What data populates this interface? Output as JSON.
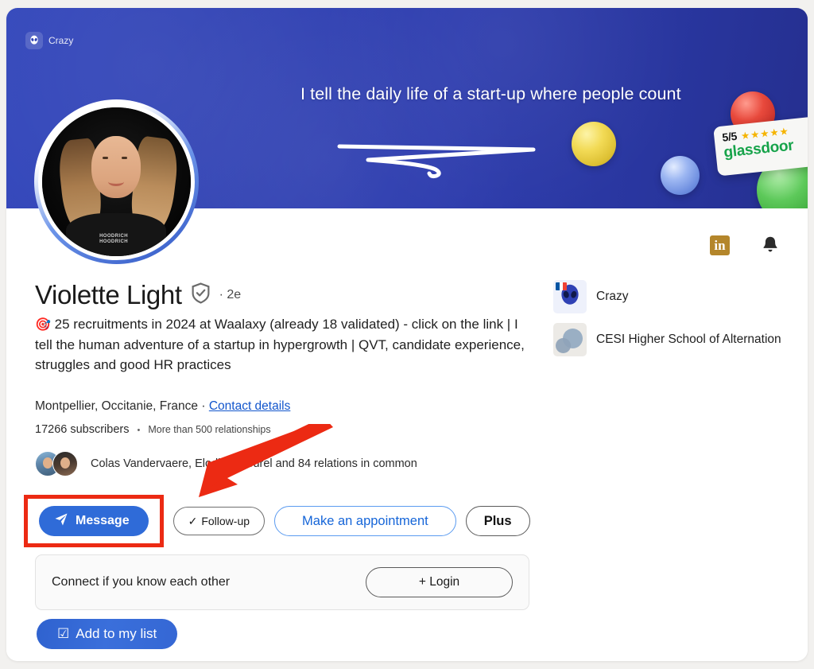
{
  "banner": {
    "chip_label": "Crazy",
    "chip_icon": "alien-icon",
    "tagline": "I tell the daily life of a start-up where people count",
    "glassdoor": {
      "score": "5/5",
      "stars": "★★★★★",
      "brand": "glassdoor"
    },
    "colors": {
      "banner_start": "#3246bb",
      "banner_end": "#252f8f",
      "sphere_yellow": "#f2da55",
      "sphere_blue": "#9db7f2",
      "sphere_red": "#e8493c",
      "sphere_green": "#5dc95a",
      "glassdoor_green": "#16a34a",
      "star_gold": "#f5b400"
    }
  },
  "social": {
    "linkedin_label": "in",
    "linkedin_color": "#b4862b",
    "bell_label": "notifications-bell"
  },
  "profile": {
    "name": "Violette Light",
    "verified_icon": "verified-shield-icon",
    "degree": "· 2e",
    "headline_emoji": "🎯",
    "headline": "25 recruitments in 2024 at Waalaxy (already 18 validated) - click on the link | I tell the human adventure of a startup in hypergrowth | QVT, candidate experience, struggles and good HR practices",
    "location": "Montpellier, Occitanie, France ·",
    "contact_details": "Contact details",
    "subscribers": "17266 subscribers",
    "separator": "•",
    "relationships": "More than 500 relationships",
    "mutual": "Colas Vandervaere, Elodie Pejeurel and 84 relations in common"
  },
  "actions": {
    "message": "Message",
    "message_icon": "send-icon",
    "followup": "Follow-up",
    "followup_icon": "check-icon",
    "appointment": "Make an appointment",
    "plus": "Plus",
    "highlight_color": "#ec2a13"
  },
  "connect": {
    "prompt": "Connect if you know each other",
    "login_button": "+ Login"
  },
  "add_list": {
    "label": "Add to my list",
    "icon": "checkbox-checked-icon"
  },
  "right_column": {
    "organizations": [
      {
        "name": "Crazy",
        "logo": "crazy-alien-logo"
      },
      {
        "name": "CESI Higher School of Alternation",
        "logo": "cesi-logo"
      }
    ]
  },
  "annotation": {
    "arrow": "red-arrow-pointing-to-message-button",
    "color": "#ec2a13"
  }
}
